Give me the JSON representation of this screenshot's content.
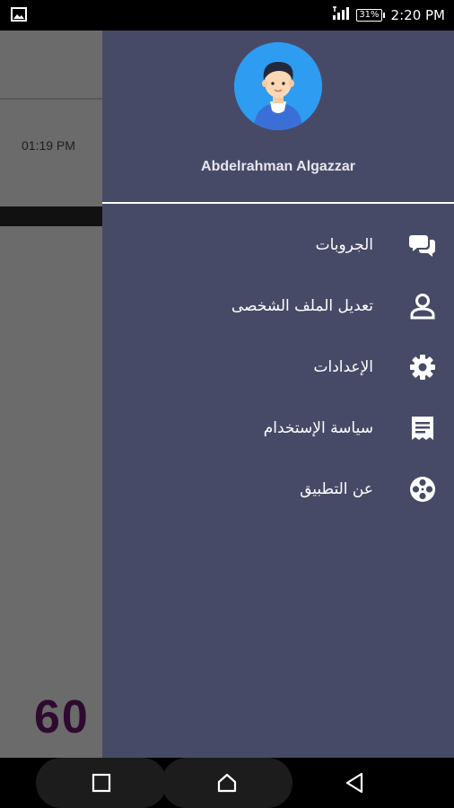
{
  "status_bar": {
    "battery": "31%",
    "time": "2:20 PM"
  },
  "background": {
    "time": "01:19 PM",
    "partial_number": "60"
  },
  "drawer": {
    "username": "Abdelrahman Algazzar",
    "menu": [
      {
        "label": "الجروبات",
        "icon": "chat-icon"
      },
      {
        "label": "تعديل الملف الشخصى",
        "icon": "person-icon"
      },
      {
        "label": "الإعدادات",
        "icon": "gear-icon"
      },
      {
        "label": "سياسة الإستخدام",
        "icon": "receipt-icon"
      },
      {
        "label": "عن التطبيق",
        "icon": "film-reel-icon"
      }
    ]
  },
  "colors": {
    "drawer_bg": "#474a67",
    "avatar_bg": "#2e9cf0",
    "scrim": "#6b6b6b"
  }
}
